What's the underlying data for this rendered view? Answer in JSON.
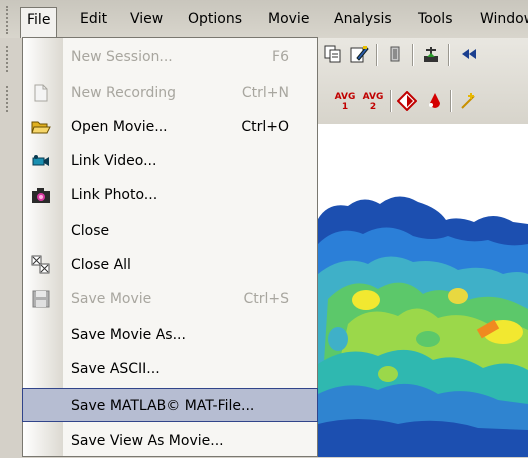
{
  "menubar": {
    "items": [
      "File",
      "Edit",
      "View",
      "Options",
      "Movie",
      "Analysis",
      "Tools",
      "Window"
    ]
  },
  "toolbar": {
    "row1_icons": [
      "copy-icon",
      "edit-icon",
      "box-icon",
      "antenna-icon",
      "rewind-icon"
    ],
    "row2": {
      "avg1_label": "AVG",
      "avg1_sub": "1",
      "avg2_label": "AVG",
      "avg2_sub": "2",
      "icons": [
        "diamond-icon",
        "drop-icon",
        "sparkle-icon"
      ]
    }
  },
  "file_menu": {
    "items": [
      {
        "label": "New Session...",
        "shortcut": "F6",
        "enabled": false,
        "icon": ""
      },
      {
        "label": "New Recording",
        "shortcut": "Ctrl+N",
        "enabled": false,
        "icon": "document-icon"
      },
      {
        "label": "Open Movie...",
        "shortcut": "Ctrl+O",
        "enabled": true,
        "icon": "folder-open-icon"
      },
      {
        "label": "Link Video...",
        "shortcut": "",
        "enabled": true,
        "icon": "camcorder-icon"
      },
      {
        "label": "Link Photo...",
        "shortcut": "",
        "enabled": true,
        "icon": "camera-icon"
      },
      {
        "label": "Close",
        "shortcut": "",
        "enabled": true,
        "icon": ""
      },
      {
        "label": "Close All",
        "shortcut": "",
        "enabled": true,
        "icon": "close-all-icon"
      },
      {
        "label": "Save Movie",
        "shortcut": "Ctrl+S",
        "enabled": false,
        "icon": "floppy-icon"
      },
      {
        "label": "Save Movie As...",
        "shortcut": "",
        "enabled": true,
        "icon": ""
      },
      {
        "label": "Save ASCII...",
        "shortcut": "",
        "enabled": true,
        "icon": ""
      },
      {
        "label": "Save MATLAB© MAT-File...",
        "shortcut": "",
        "enabled": true,
        "icon": "",
        "highlighted": true
      },
      {
        "label": "Save View As Movie...",
        "shortcut": "",
        "enabled": true,
        "icon": ""
      }
    ]
  },
  "colors": {
    "highlight_bg": "#b6bdd2",
    "highlight_border": "#31448a",
    "disabled_text": "#a8a69f"
  }
}
